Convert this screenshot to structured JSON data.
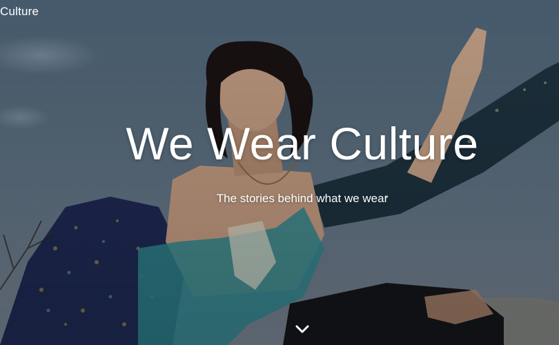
{
  "header": {
    "brand_label": "Culture"
  },
  "hero": {
    "title": "We Wear Culture",
    "subtitle": "The stories behind what we wear",
    "scroll_icon": "chevron-down-icon"
  }
}
